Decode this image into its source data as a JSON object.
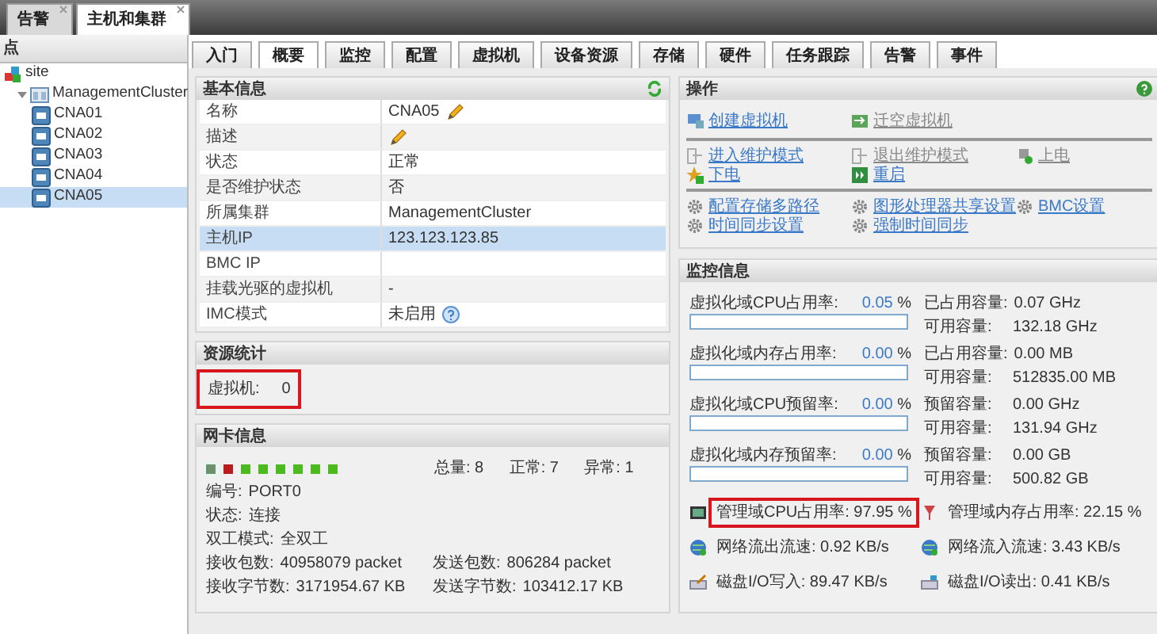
{
  "doc_tabs": [
    {
      "label": "告警",
      "selected": false
    },
    {
      "label": "主机和集群",
      "selected": true
    }
  ],
  "sidebar": {
    "title": "点",
    "tree": [
      {
        "label": "site",
        "kind": "site",
        "selected": false,
        "children": [
          {
            "label": "ManagementCluster",
            "kind": "cluster",
            "selected": false,
            "expanded": true,
            "children": [
              {
                "label": "CNA01",
                "kind": "host",
                "selected": false
              },
              {
                "label": "CNA02",
                "kind": "host",
                "selected": false
              },
              {
                "label": "CNA03",
                "kind": "host",
                "selected": false
              },
              {
                "label": "CNA04",
                "kind": "host",
                "selected": false
              },
              {
                "label": "CNA05",
                "kind": "host",
                "selected": true
              }
            ]
          }
        ]
      }
    ]
  },
  "tabs": [
    {
      "label": "入门",
      "selected": false
    },
    {
      "label": "概要",
      "selected": true
    },
    {
      "label": "监控",
      "selected": false
    },
    {
      "label": "配置",
      "selected": false
    },
    {
      "label": "虚拟机",
      "selected": false
    },
    {
      "label": "设备资源",
      "selected": false
    },
    {
      "label": "存储",
      "selected": false
    },
    {
      "label": "硬件",
      "selected": false
    },
    {
      "label": "任务跟踪",
      "selected": false
    },
    {
      "label": "告警",
      "selected": false
    },
    {
      "label": "事件",
      "selected": false
    }
  ],
  "basic_info": {
    "title": "基本信息",
    "rows": [
      {
        "label": "名称",
        "value": "CNA05",
        "kind": "editable",
        "selected": false
      },
      {
        "label": "描述",
        "kind": "editable",
        "selected": false
      },
      {
        "label": "状态",
        "value": "正常",
        "kind": "text",
        "selected": false
      },
      {
        "label": "是否维护状态",
        "value": "否",
        "kind": "text",
        "selected": false
      },
      {
        "label": "所属集群",
        "value": "ManagementCluster",
        "kind": "text",
        "selected": false
      },
      {
        "label": "主机IP",
        "value": "123.123.123.85",
        "kind": "text",
        "selected": true
      },
      {
        "label": "BMC IP",
        "kind": "text",
        "selected": false
      },
      {
        "label": "挂载光驱的虚拟机",
        "value": "-",
        "kind": "text",
        "selected": false
      },
      {
        "label": "IMC模式",
        "value": "未启用",
        "kind": "help",
        "selected": false
      }
    ]
  },
  "resource_stats": {
    "title": "资源统计",
    "items": [
      {
        "label": "虚拟机:",
        "value": "0",
        "highlighted": true
      }
    ]
  },
  "nic_info": {
    "title": "网卡信息",
    "ports": [
      {
        "color": "#6f8f6f",
        "selected": true
      },
      {
        "color": "#b81c1c",
        "selected": false
      },
      {
        "color": "#4cb91e",
        "selected": false
      },
      {
        "color": "#4cb91e",
        "selected": false
      },
      {
        "color": "#4cb91e",
        "selected": false
      },
      {
        "color": "#4cb91e",
        "selected": false
      },
      {
        "color": "#4cb91e",
        "selected": false
      },
      {
        "color": "#4cb91e",
        "selected": false
      }
    ],
    "summary": [
      {
        "label": "总量:",
        "value": "8"
      },
      {
        "label": "正常:",
        "value": "7"
      },
      {
        "label": "异常:",
        "value": "1"
      }
    ],
    "details": [
      [
        {
          "label": "编号:",
          "value": "PORT0"
        }
      ],
      [
        {
          "label": "状态:",
          "value": "连接"
        }
      ],
      [
        {
          "label": "双工模式:",
          "value": "全双工"
        }
      ],
      [
        {
          "label": "接收包数:",
          "value": "40958079 packet"
        },
        {
          "label": "发送包数:",
          "value": "806284 packet"
        }
      ],
      [
        {
          "label": "接收字节数:",
          "value": "3171954.67 KB"
        },
        {
          "label": "发送字节数:",
          "value": "103412.17 KB"
        }
      ]
    ]
  },
  "operations": {
    "title": "操作",
    "groups": [
      [
        {
          "label": "创建虚拟机",
          "kind": "create",
          "disabled": false
        },
        {
          "label": "迁空虚拟机",
          "kind": "migrate",
          "disabled": true
        }
      ],
      [
        {
          "label": "进入维护模式",
          "kind": "enter",
          "disabled": false
        },
        {
          "label": "退出维护模式",
          "kind": "exit",
          "disabled": true
        },
        {
          "label": "上电",
          "kind": "poweron",
          "disabled": true
        },
        {
          "label": "下电",
          "kind": "poweroff",
          "disabled": false
        },
        {
          "label": "重启",
          "kind": "restart",
          "disabled": false
        }
      ],
      [
        {
          "label": "配置存储多路径",
          "kind": "gear",
          "disabled": false
        },
        {
          "label": "图形处理器共享设置",
          "kind": "gear",
          "disabled": false
        },
        {
          "label": "BMC设置",
          "kind": "gear",
          "disabled": false
        },
        {
          "label": "时间同步设置",
          "kind": "gear",
          "disabled": false
        },
        {
          "label": "强制时间同步",
          "kind": "gear",
          "disabled": false
        }
      ]
    ]
  },
  "monitor": {
    "title": "监控信息",
    "meters": [
      {
        "label": "虚拟化域CPU占用率:",
        "value": "0.05",
        "unit": "%",
        "level": 0.0005,
        "stats": [
          {
            "label": "已占用容量:",
            "value": "0.07 GHz"
          },
          {
            "label": "可用容量:",
            "value": "132.18 GHz"
          }
        ]
      },
      {
        "label": "虚拟化域内存占用率:",
        "value": "0.00",
        "unit": "%",
        "level": 0,
        "stats": [
          {
            "label": "已占用容量:",
            "value": "0.00 MB"
          },
          {
            "label": "可用容量:",
            "value": "512835.00 MB"
          }
        ]
      },
      {
        "label": "虚拟化域CPU预留率:",
        "value": "0.00",
        "unit": "%",
        "level": 0,
        "stats": [
          {
            "label": "预留容量:",
            "value": "0.00 GHz"
          },
          {
            "label": "可用容量:",
            "value": "131.94 GHz"
          }
        ]
      },
      {
        "label": "虚拟化域内存预留率:",
        "value": "0.00",
        "unit": "%",
        "level": 0,
        "stats": [
          {
            "label": "预留容量:",
            "value": "0.00 GB"
          },
          {
            "label": "可用容量:",
            "value": "500.82 GB"
          }
        ]
      }
    ],
    "metrics": [
      {
        "label": "管理域CPU占用率:",
        "value": "97.95 %",
        "kind": "cpu",
        "highlighted": true
      },
      {
        "label": "管理域内存占用率:",
        "value": "22.15 %",
        "kind": "memory",
        "highlighted": false
      },
      {
        "label": "网络流出流速:",
        "value": "0.92 KB/s",
        "kind": "netout",
        "highlighted": false
      },
      {
        "label": "网络流入流速:",
        "value": "3.43 KB/s",
        "kind": "netin",
        "highlighted": false
      },
      {
        "label": "磁盘I/O写入:",
        "value": "89.47 KB/s",
        "kind": "diskwrite",
        "highlighted": false
      },
      {
        "label": "磁盘I/O读出:",
        "value": "0.41 KB/s",
        "kind": "diskread",
        "highlighted": false
      }
    ]
  }
}
